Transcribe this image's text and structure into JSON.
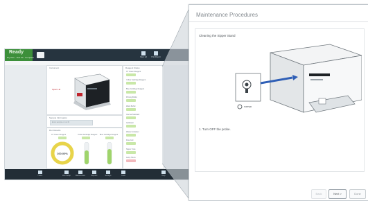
{
  "app": {
    "status": {
      "title": "Ready",
      "subtitle": "Dry Run · Test Kit · Complete"
    },
    "header_buttons": [
      "Open Lid",
      "Print Report"
    ],
    "panels": {
      "instrument_title": "Instrument",
      "instrument_callout": "Open Lid",
      "search_title": "Sample Information",
      "search_placeholder": "Enter sample or run ID",
      "results_title": "Run Results",
      "gauge_value": "100.00%",
      "reagents_title": "Reagent Status"
    },
    "reagents": [
      "CT Green Reagent",
      "Yellow Cartridge Reagent",
      "Blue Cartridge Reagent",
      "Priming Buffer",
      "Wash Buffer",
      "Internal Standard",
      "Calibrator",
      "Waste Container",
      "Flow Cell",
      "Sipper Tube",
      "Lamp Hours"
    ],
    "bottom_buttons": [
      "Home",
      "Run Setup",
      "Maintenance",
      "Reports",
      "Settings",
      "Tools",
      "Help"
    ]
  },
  "dialog": {
    "title": "Maintenance Procedures",
    "subtitle": "Cleaning the Sipper Stand",
    "step_text": "1. Turn OFF the probe.",
    "callout_label": "SIPPER",
    "buttons": {
      "back": "Back",
      "next": "Next >",
      "done": "Done"
    }
  },
  "colors": {
    "ready_green": "#3c8f3a",
    "header": "#26343f",
    "gauge": "#e8d44a"
  }
}
